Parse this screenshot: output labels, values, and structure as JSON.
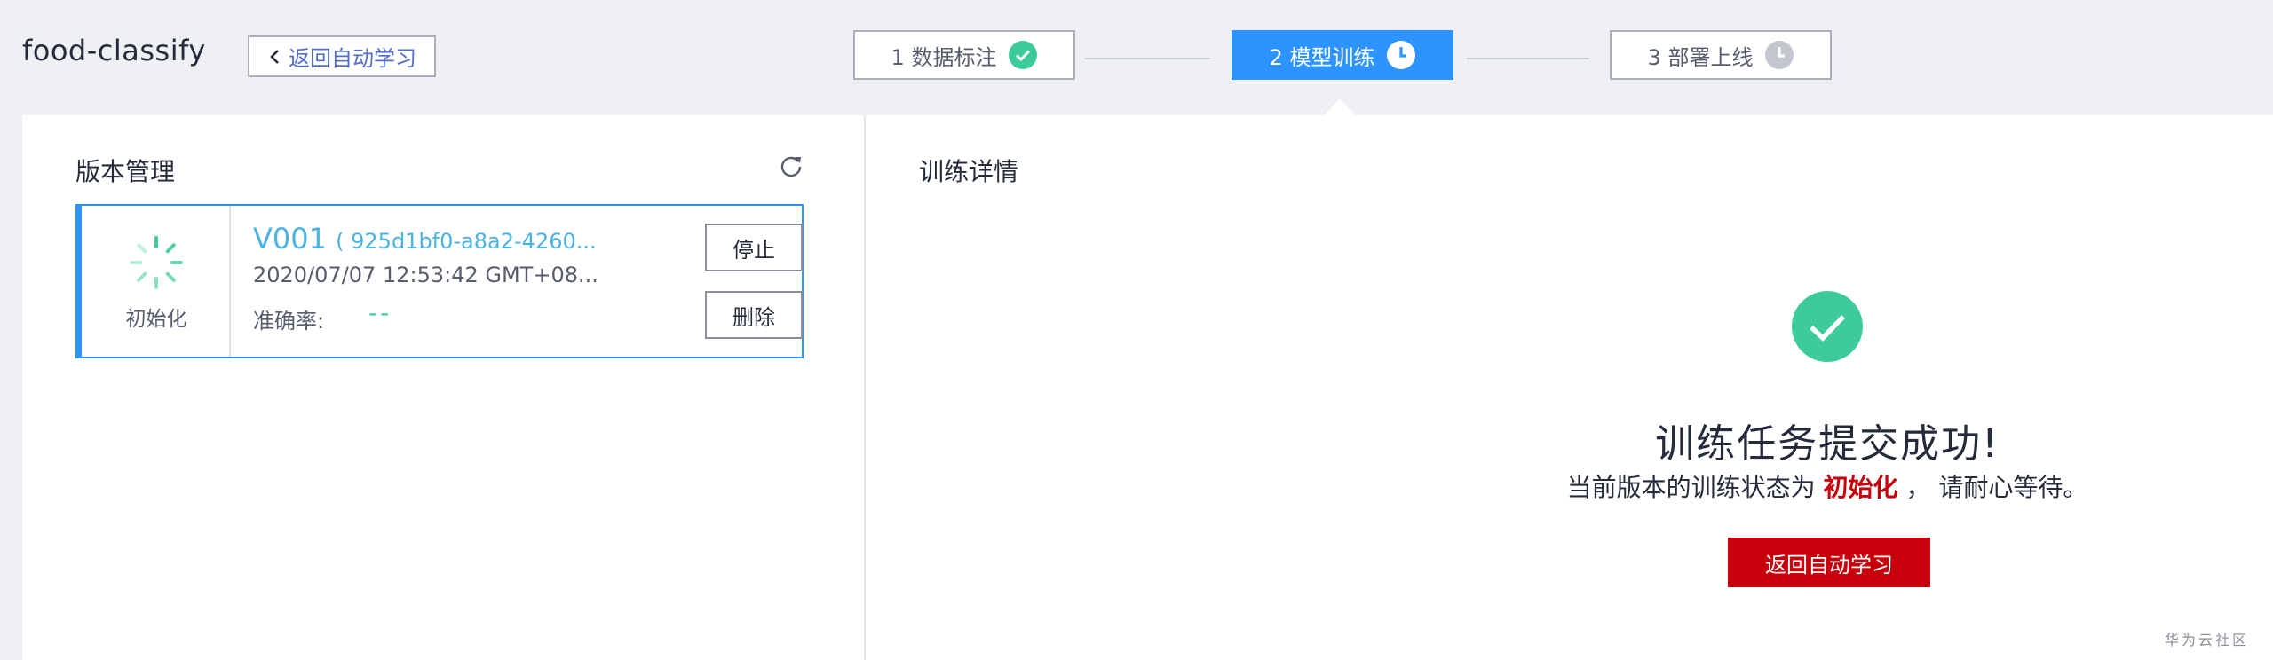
{
  "header": {
    "project_name": "food-classify",
    "back_label": "返回自动学习"
  },
  "steps": [
    {
      "label": "1 数据标注",
      "status": "done",
      "icon": "check-circle-icon"
    },
    {
      "label": "2 模型训练",
      "status": "active",
      "icon": "clock-icon"
    },
    {
      "label": "3 部署上线",
      "status": "pending",
      "icon": "clock-icon"
    }
  ],
  "version_panel": {
    "title": "版本管理",
    "refresh_icon": "refresh-icon",
    "card": {
      "status": "初始化",
      "version": "V001",
      "hash": "( 925d1bf0-a8a2-4260...",
      "time": "2020/07/07 12:53:42 GMT+08...",
      "accuracy_label": "准确率:",
      "accuracy_value": "--",
      "stop_label": "停止",
      "delete_label": "删除"
    }
  },
  "detail_panel": {
    "title": "训练详情",
    "success_title": "训练任务提交成功!",
    "desc_prefix": "当前版本的训练状态为",
    "desc_status": "初始化",
    "desc_suffix": "， 请耐心等待。",
    "back_button": "返回自动学习"
  },
  "watermark": "华为云社区",
  "colors": {
    "brand_blue": "#2d94ff",
    "success_green": "#3ecb9a",
    "danger_red": "#c7000b"
  }
}
